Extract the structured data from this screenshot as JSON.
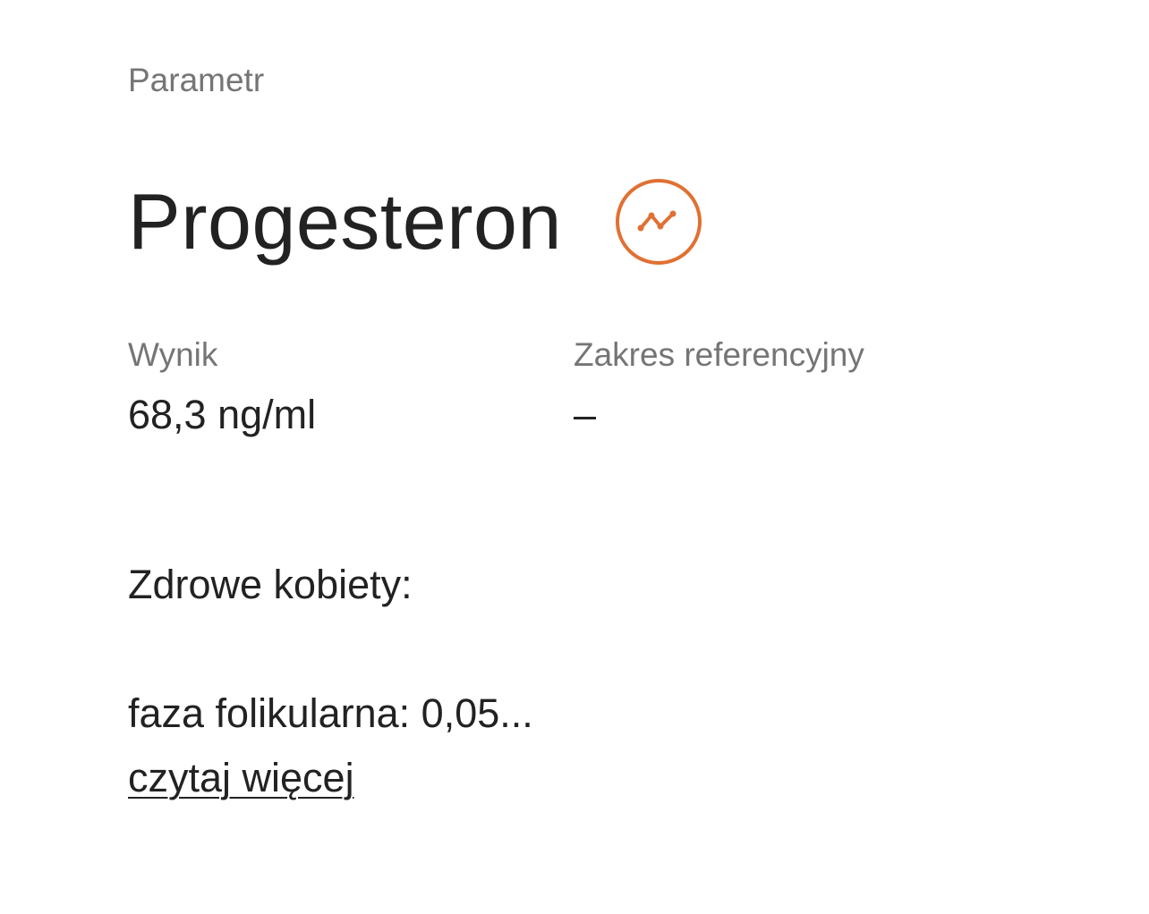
{
  "section_label": "Parametr",
  "parameter": {
    "name": "Progesteron",
    "trend_icon": "trend-chart-icon",
    "accent_color": "#E07033"
  },
  "result": {
    "label": "Wynik",
    "value": "68,3 ng/ml"
  },
  "reference": {
    "label": "Zakres referencyjny",
    "value": "–"
  },
  "description": {
    "line1": "Zdrowe kobiety:",
    "line2": "faza folikularna: 0,05...",
    "read_more": "czytaj więcej"
  }
}
